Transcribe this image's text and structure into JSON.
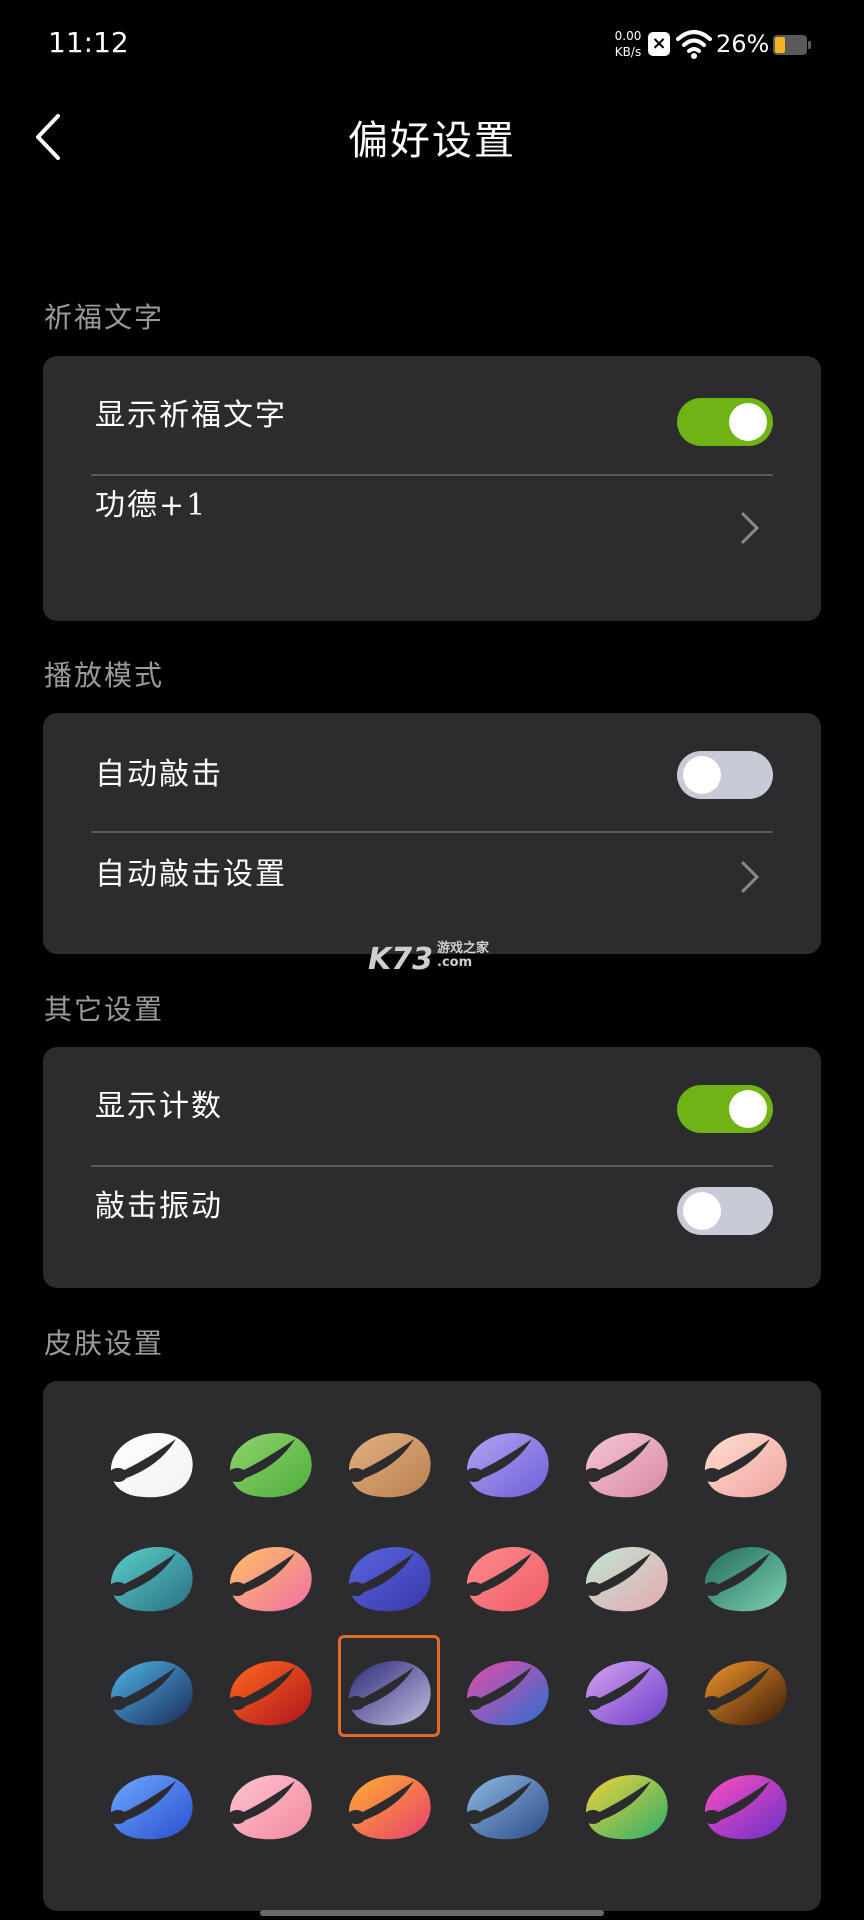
{
  "status": {
    "time": "11:12",
    "net_speed": "0.00",
    "net_unit": "KB/s",
    "battery": "26%"
  },
  "header": {
    "title": "偏好设置"
  },
  "sections": {
    "prayer": {
      "title": "祈福文字",
      "show_prayer_label": "显示祈福文字",
      "show_prayer_on": true,
      "merit_label": "功德+1"
    },
    "playback": {
      "title": "播放模式",
      "auto_tap_label": "自动敲击",
      "auto_tap_on": false,
      "auto_tap_settings_label": "自动敲击设置"
    },
    "other": {
      "title": "其它设置",
      "show_count_label": "显示计数",
      "show_count_on": true,
      "vibrate_label": "敲击振动",
      "vibrate_on": false
    },
    "skins": {
      "title": "皮肤设置",
      "selected_index": 14,
      "items": [
        {
          "name": "white",
          "c1": "#ffffff",
          "c2": "#f2f2f2"
        },
        {
          "name": "green",
          "c1": "#8fd46a",
          "c2": "#4fae3c"
        },
        {
          "name": "tan",
          "c1": "#e4b183",
          "c2": "#b8804f"
        },
        {
          "name": "lavender",
          "c1": "#b4a4f0",
          "c2": "#6b5fd8"
        },
        {
          "name": "pink",
          "c1": "#f6c6d4",
          "c2": "#d98aa2"
        },
        {
          "name": "peach",
          "c1": "#fde0cf",
          "c2": "#f1a3a0"
        },
        {
          "name": "teal",
          "c1": "#5ad0c8",
          "c2": "#2b6f86"
        },
        {
          "name": "orange-pink",
          "c1": "#ffc163",
          "c2": "#ee6fa6"
        },
        {
          "name": "indigo",
          "c1": "#5a66e0",
          "c2": "#3a36a8"
        },
        {
          "name": "coral",
          "c1": "#ff8c8c",
          "c2": "#ee5c66"
        },
        {
          "name": "mint-rose",
          "c1": "#bfe6cf",
          "c2": "#e6a9b3"
        },
        {
          "name": "emerald-art",
          "c1": "#1f6b5c",
          "c2": "#7fd1b3"
        },
        {
          "name": "ocean-art",
          "c1": "#4fb5e8",
          "c2": "#1b2a5a"
        },
        {
          "name": "fire-art",
          "c1": "#ff6a1e",
          "c2": "#b0131c"
        },
        {
          "name": "marble-art",
          "c1": "#2d2a78",
          "c2": "#c0bde0"
        },
        {
          "name": "nebula-art",
          "c1": "#e64ca8",
          "c2": "#2a6fd0"
        },
        {
          "name": "violet-art",
          "c1": "#d7a2f2",
          "c2": "#6b3fc8"
        },
        {
          "name": "lava-art",
          "c1": "#f1962a",
          "c2": "#3a1a0a"
        },
        {
          "name": "blue-art",
          "c1": "#6ea8ff",
          "c2": "#2a4fcf"
        },
        {
          "name": "rose-art",
          "c1": "#ffc3cf",
          "c2": "#f08a9f"
        },
        {
          "name": "sunset-art",
          "c1": "#ffb02e",
          "c2": "#e83f6f"
        },
        {
          "name": "storm-art",
          "c1": "#8fbbe0",
          "c2": "#2a4a8a"
        },
        {
          "name": "mosaic-art",
          "c1": "#f4d23a",
          "c2": "#2aaf6a"
        },
        {
          "name": "magenta-art",
          "c1": "#ff4fc0",
          "c2": "#6a2fc8"
        }
      ]
    }
  },
  "watermark": {
    "text": "K73",
    "sub1": "游戏之家",
    "sub2": ".com"
  }
}
